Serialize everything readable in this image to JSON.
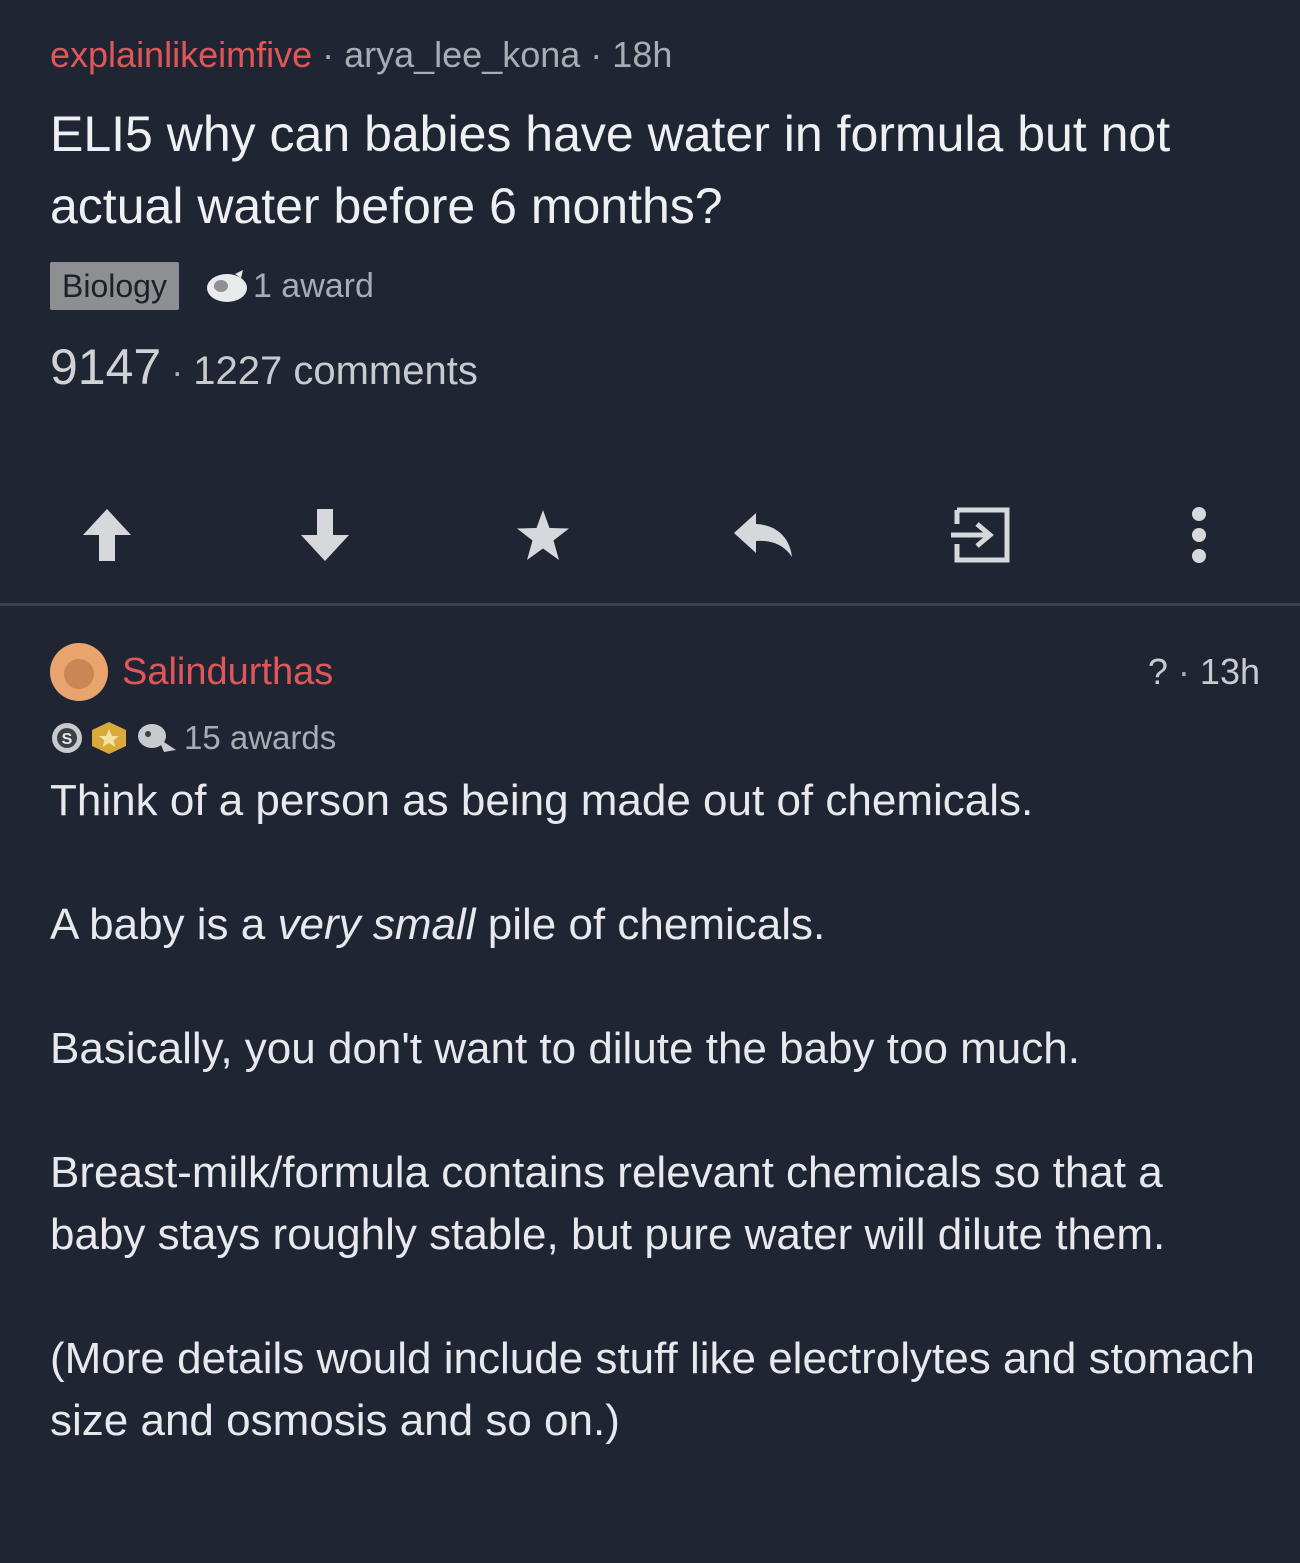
{
  "post": {
    "subreddit": "explainlikeimfive",
    "author": "arya_lee_kona",
    "age": "18h",
    "separator": "·",
    "title": "ELI5 why can babies have water in formula but not actual water before 6 months?",
    "flair": "Biology",
    "awards": "1 award",
    "score": "9147",
    "comments": "1227 comments"
  },
  "actions": {
    "icons": [
      "upvote-icon",
      "downvote-icon",
      "star-icon",
      "reply-icon",
      "share-icon",
      "more-icon"
    ]
  },
  "comment": {
    "author": "Salindurthas",
    "score_hidden": "?",
    "age": "13h",
    "awards": "15 awards",
    "paragraphs": {
      "p1": "Think of a person as being made out of chemicals.",
      "p2_before": "A baby is a ",
      "p2_emph": "very small",
      "p2_after": " pile of chemicals.",
      "p3": "Basically, you don't want to dilute the baby too much.",
      "p4": "Breast-milk/formula contains relevant chemicals so that a baby stays roughly stable, but pure water will dilute them.",
      "p5": "(More details would include stuff like electrolytes and stomach size and osmosis and so on.)"
    }
  },
  "colors": {
    "background": "#1f2532",
    "accent_red": "#e0575a",
    "muted_text": "#a9acb3",
    "icon": "#d6d8dc"
  }
}
